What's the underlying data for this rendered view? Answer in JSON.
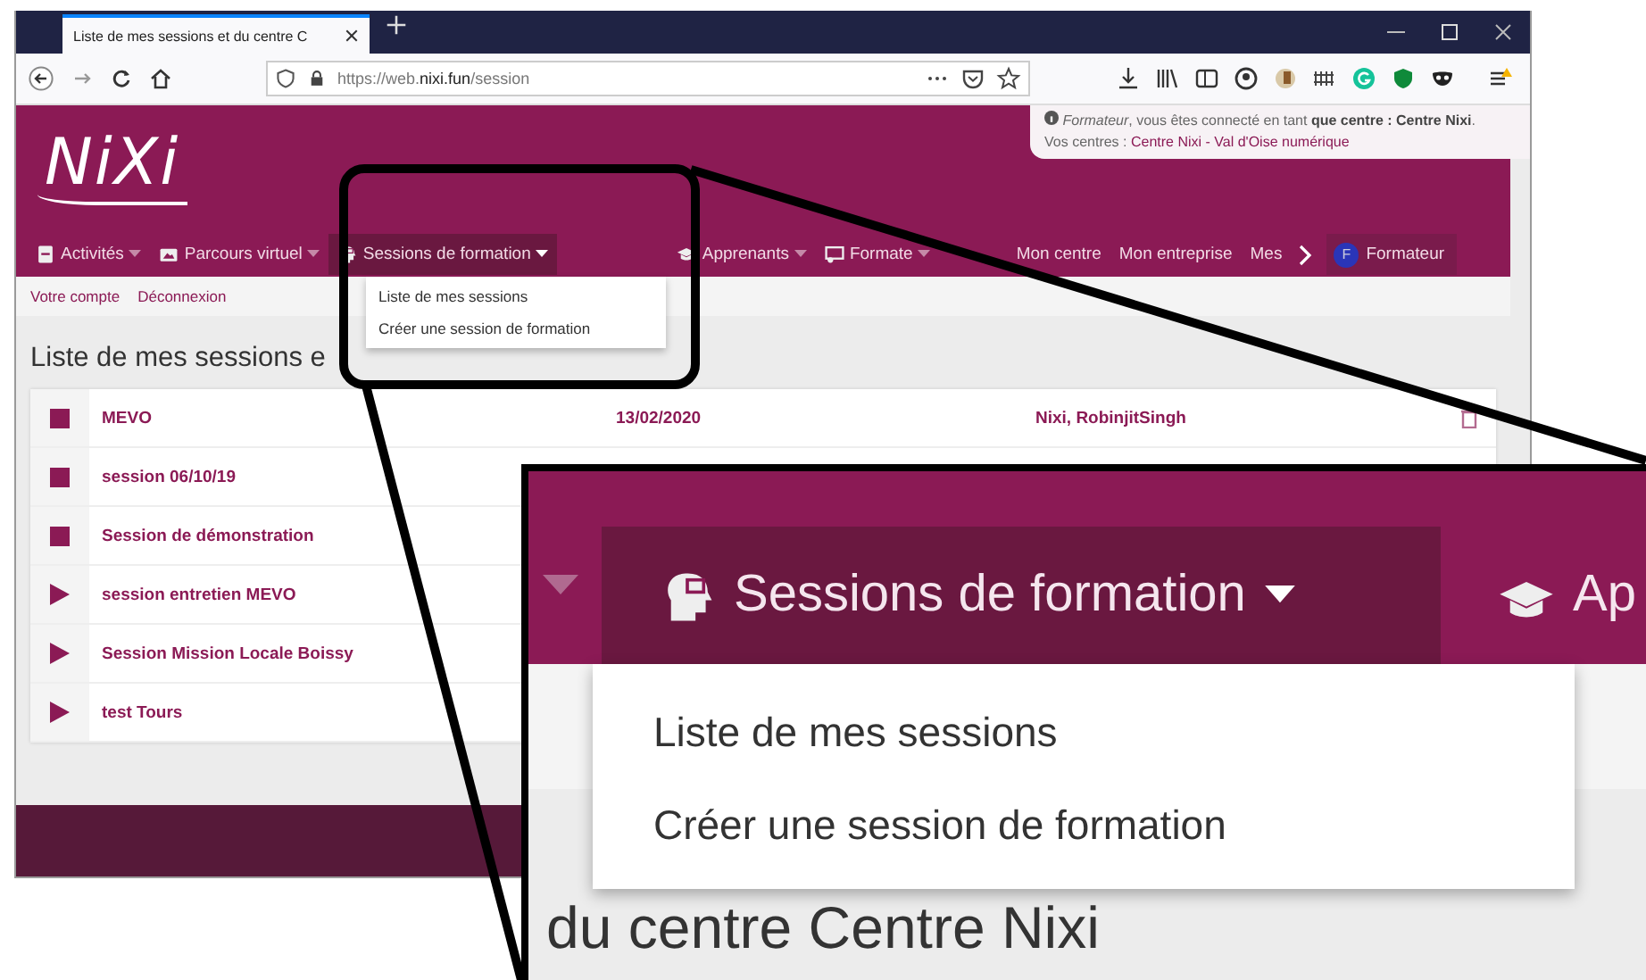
{
  "browser": {
    "tab_title": "Liste de mes sessions et du centre C",
    "url": "https://web.**nixi.fun**/session"
  },
  "info": {
    "message": "*Formateur*, vous êtes connecté en tant **que centre : Centre Nixi**.",
    "centres_label": "Vos centres :",
    "centres_link": "Centre Nixi - Val d'Oise numérique"
  },
  "logo": "NiXi",
  "nav": [
    {
      "label": "Activités",
      "dropdown": true,
      "selected": false
    },
    {
      "label": "Parcours virtuel",
      "dropdown": true,
      "selected": false
    },
    {
      "label": "Sessions de formation",
      "dropdown": true,
      "selected": true
    },
    {
      "label": "Apprenants",
      "dropdown": true,
      "selected": false
    },
    {
      "label": "Formate",
      "dropdown": true,
      "selected": false
    },
    {
      "label": "Mon centre",
      "dropdown": false,
      "selected": false
    },
    {
      "label": "Mon entreprise",
      "dropdown": false,
      "selected": false
    },
    {
      "label": "Mes",
      "dropdown": false,
      "selected": false
    }
  ],
  "user": {
    "avatar": "F",
    "name": "Formateur"
  },
  "account_links": [
    "Votre compte",
    "Déconnexion"
  ],
  "dropdown": {
    "items": [
      "Liste de mes sessions",
      "Créer une session de formation"
    ]
  },
  "heading": "Liste de mes sessions e",
  "sessions": [
    {
      "name": "MEVO",
      "kind": "stopped",
      "date": "13/02/2020",
      "trainers": "Nixi, RobinjitSingh"
    },
    {
      "name": "session 06/10/19",
      "kind": "stopped"
    },
    {
      "name": "Session de démonstration",
      "kind": "stopped"
    },
    {
      "name": "session entretien MEVO",
      "kind": "playing"
    },
    {
      "name": "Session Mission Locale Boissy",
      "kind": "playing"
    },
    {
      "name": "test Tours",
      "kind": "playing"
    }
  ],
  "zoom": {
    "menu_label": "Sessions de formation",
    "next_label": "Ap",
    "items": [
      "Liste de mes sessions",
      "Créer une session de formation"
    ],
    "heading_fragment": "du centre Centre Nixi"
  }
}
